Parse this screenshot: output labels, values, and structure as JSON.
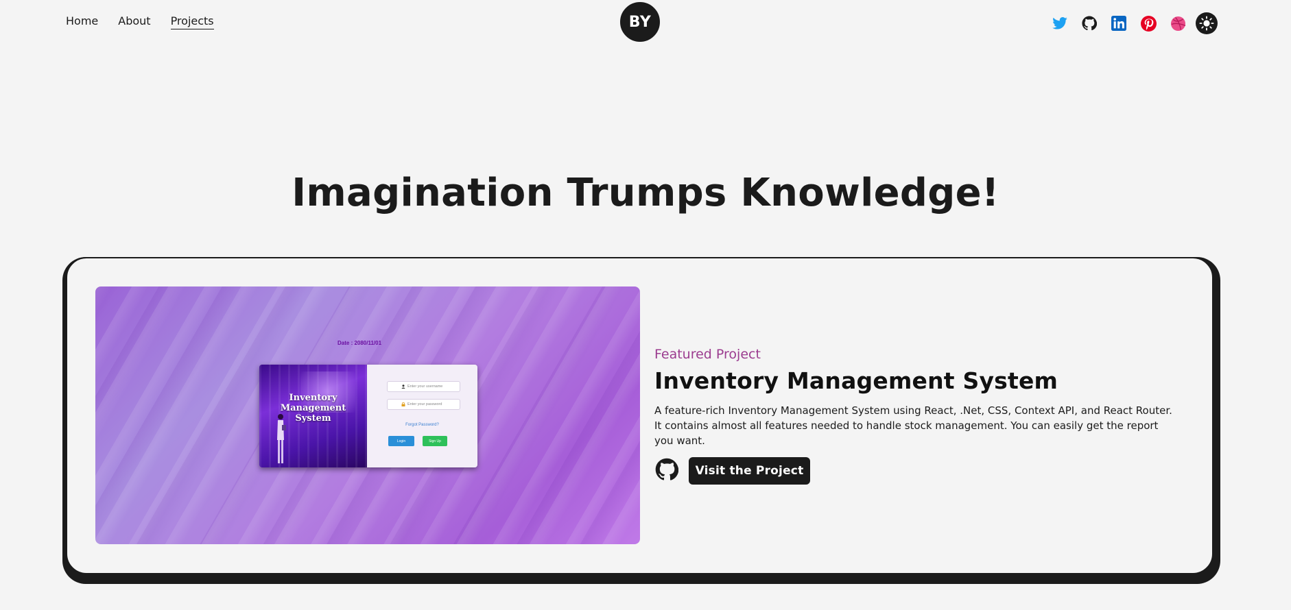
{
  "nav": {
    "items": [
      {
        "label": "Home",
        "active": false
      },
      {
        "label": "About",
        "active": false
      },
      {
        "label": "Projects",
        "active": true
      }
    ]
  },
  "logo": {
    "text": "BY"
  },
  "socials": [
    {
      "icon": "twitter-icon",
      "color": "#1da1f2"
    },
    {
      "icon": "github-icon",
      "color": "#1b1b1b"
    },
    {
      "icon": "linkedin-icon",
      "color": "#0a66c2"
    },
    {
      "icon": "pinterest-icon",
      "color": "#e60023"
    },
    {
      "icon": "dribbble-icon",
      "color": "#ea4c89"
    },
    {
      "icon": "theme-toggle-sun-icon",
      "color": "#1b1b1b"
    }
  ],
  "hero": {
    "title": "Imagination Trumps Knowledge!"
  },
  "featured": {
    "label": "Featured Project",
    "title": "Inventory Management System",
    "description": "A feature-rich Inventory Management System using React, .Net, CSS, Context API, and React Router. It contains almost all features needed to handle stock management. You can easily get the report you want.",
    "visit_label": "Visit the Project",
    "screenshot": {
      "date_text": "Date : 2080/11/01",
      "app_title": "Inventory Management System",
      "username_placeholder": "Enter your username",
      "password_placeholder": "Enter your password",
      "forgot_text": "Forgot Password?",
      "login_label": "Login",
      "signup_label": "Sign Up"
    }
  },
  "colors": {
    "background": "#f4f4f4",
    "dark": "#1b1b1b",
    "accent": "#9b3c8f"
  }
}
